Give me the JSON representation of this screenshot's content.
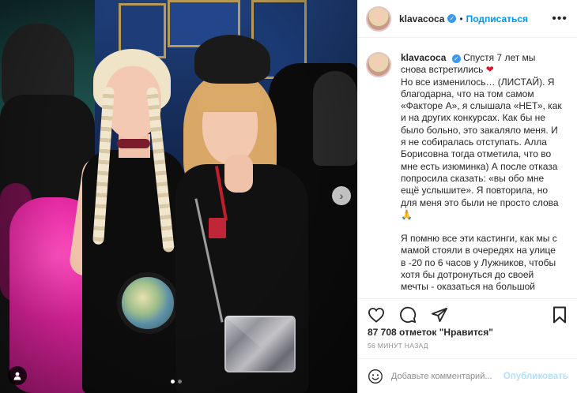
{
  "header": {
    "username": "klavacoca",
    "separator": "•",
    "follow_label": "Подписаться",
    "more_label": "•••"
  },
  "caption": {
    "username": "klavacoca",
    "line1": "Спустя 7 лет мы снова встретились",
    "heart": "❤",
    "paragraph1": "Но все изменилось… (ЛИСТАЙ). Я благодарна, что на том самом «Факторе А», я слышала «НЕТ», как и на других конкурсах. Как бы не было больно, это закаляло меня. И я не собиралась отступать. Алла Борисовна тогда отметила, что во мне есть изюминка) А после отказа попросила сказать: «вы обо мне ещё услышите». Я повторила, но для меня это были не просто слова 🙏",
    "paragraph2": "Я помню все эти кастинги, как мы с мамой стояли в очередях на улице в -20 по 6 часов у Лужников, чтобы хотя бы дотронуться до своей мечты - оказаться на большой"
  },
  "stats": {
    "likes": "87 708 отметок \"Нравится\"",
    "time": "56 минут назад"
  },
  "comment": {
    "placeholder": "Добавьте комментарий...",
    "post_label": "Опубликовать"
  },
  "carousel": {
    "next_glyph": "›",
    "slide_count": 2,
    "active_index": 0
  },
  "icons": {
    "like": "heart-outline-icon",
    "comment": "comment-icon",
    "share": "paper-plane-icon",
    "save": "bookmark-icon",
    "emoji": "smiley-icon",
    "tag": "user-tag-icon",
    "verified": "verified-badge-icon"
  },
  "colors": {
    "accent": "#0095f6",
    "verified": "#3897f0",
    "heart": "#e0142b",
    "post_disabled": "#b2dffc",
    "muted": "#8e8e8e"
  }
}
